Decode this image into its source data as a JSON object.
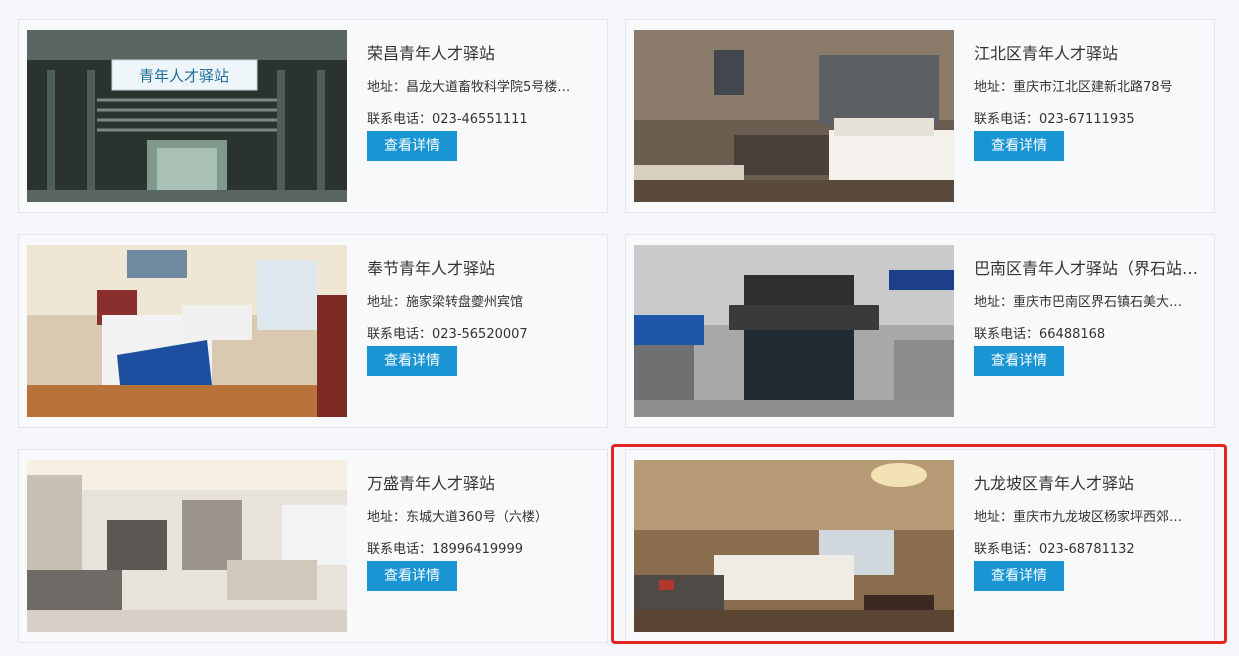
{
  "colors": {
    "button_bg": "#1a95d3",
    "highlight": "#e42222"
  },
  "cards": [
    {
      "title": "荣昌青年人才驿站",
      "address": "地址：昌龙大道畜牧科学院5号楼（...",
      "phone": "联系电话：023-46551111",
      "button": "查看详情",
      "sign_text": "青年人才驿站"
    },
    {
      "title": "江北区青年人才驿站",
      "address": "地址：重庆市江北区建新北路78号",
      "phone": "联系电话：023-67111935",
      "button": "查看详情"
    },
    {
      "title": "奉节青年人才驿站",
      "address": "地址：施家梁转盘夔州宾馆",
      "phone": "联系电话：023-56520007",
      "button": "查看详情"
    },
    {
      "title": "巴南区青年人才驿站（界石站）...",
      "address": "地址：重庆市巴南区界石镇石美大道...",
      "phone": "联系电话：66488168",
      "button": "查看详情"
    },
    {
      "title": "万盛青年人才驿站",
      "address": "地址：东城大道360号（六楼）",
      "phone": "联系电话：18996419999",
      "button": "查看详情"
    },
    {
      "title": "九龙坡区青年人才驿站",
      "address": "地址：重庆市九龙坡区杨家坪西郊路...",
      "phone": "联系电话：023-68781132",
      "button": "查看详情"
    }
  ]
}
